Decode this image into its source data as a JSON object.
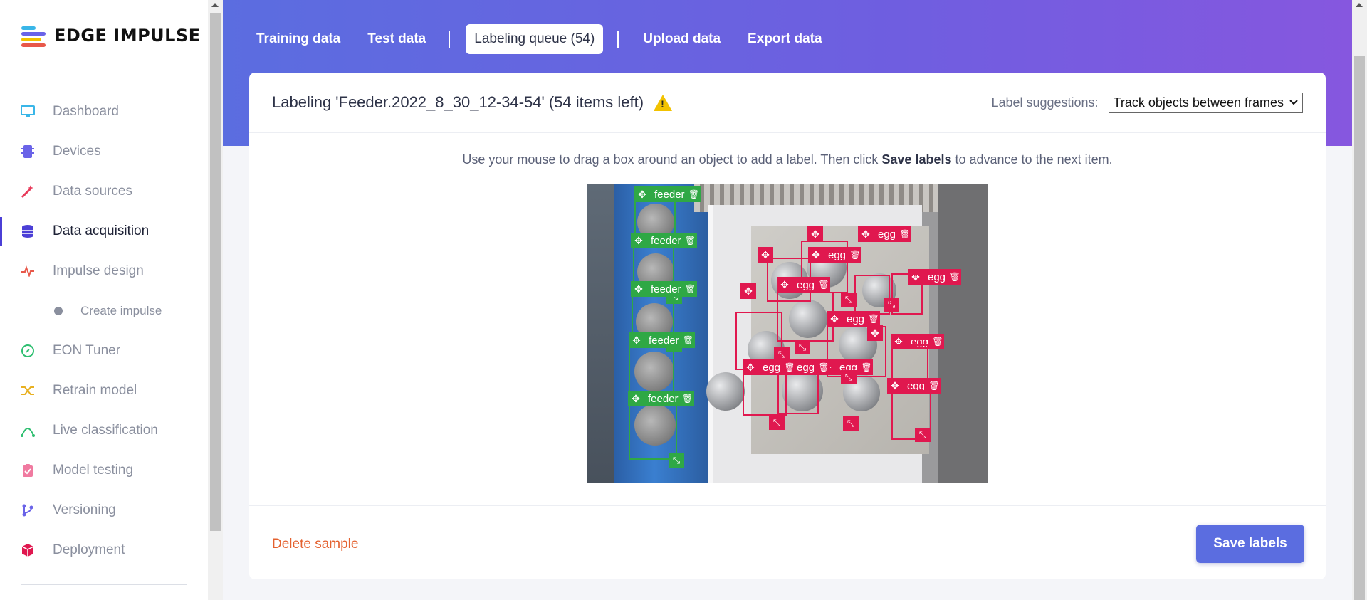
{
  "brand": {
    "name": "EDGE IMPULSE",
    "colors": [
      "#5b6de0",
      "#f2c200",
      "#e0184f",
      "#2fa845"
    ]
  },
  "sidebar": {
    "items": [
      {
        "label": "Dashboard",
        "icon": "monitor-icon",
        "color": "#39b6e8"
      },
      {
        "label": "Devices",
        "icon": "chip-icon",
        "color": "#6a63e8"
      },
      {
        "label": "Data sources",
        "icon": "wand-icon",
        "color": "#e83a5a"
      },
      {
        "label": "Data acquisition",
        "icon": "database-icon",
        "color": "#4b3fd6",
        "active": true
      },
      {
        "label": "Impulse design",
        "icon": "pulse-icon",
        "color": "#e8584a"
      },
      {
        "label": "Create impulse",
        "icon": "dot-icon",
        "sub": true
      },
      {
        "label": "EON Tuner",
        "icon": "compass-icon",
        "color": "#2fbf71"
      },
      {
        "label": "Retrain model",
        "icon": "shuffle-icon",
        "color": "#e8b020"
      },
      {
        "label": "Live classification",
        "icon": "signal-icon",
        "color": "#2fbf71"
      },
      {
        "label": "Model testing",
        "icon": "clipboard-icon",
        "color": "#f07aa0"
      },
      {
        "label": "Versioning",
        "icon": "branch-icon",
        "color": "#6a63e8"
      },
      {
        "label": "Deployment",
        "icon": "box-icon",
        "color": "#e0184f"
      }
    ]
  },
  "tabs": [
    {
      "label": "Training data"
    },
    {
      "label": "Test data"
    },
    {
      "label": "Labeling queue (54)",
      "active": true
    },
    {
      "label": "Upload data"
    },
    {
      "label": "Export data"
    }
  ],
  "card": {
    "title": "Labeling 'Feeder.2022_8_30_12-34-54' (54 items left)",
    "suggestions_label": "Label suggestions:",
    "suggestions_value": "Track objects between frames",
    "instruction_pre": "Use your mouse to drag a box around an object to add a label. Then click ",
    "instruction_bold": "Save labels",
    "instruction_post": " to advance to the next item.",
    "delete_label": "Delete sample",
    "save_label": "Save labels"
  },
  "boxes": [
    {
      "label": "feeder",
      "kind": "g"
    },
    {
      "label": "feeder",
      "kind": "g"
    },
    {
      "label": "feeder",
      "kind": "g"
    },
    {
      "label": "feeder",
      "kind": "g"
    },
    {
      "label": "feeder",
      "kind": "g"
    },
    {
      "label": "egg",
      "kind": "r"
    },
    {
      "label": "egg",
      "kind": "r"
    },
    {
      "label": "egg",
      "kind": "r"
    },
    {
      "label": "egg",
      "kind": "r"
    },
    {
      "label": "egg",
      "kind": "r"
    },
    {
      "label": "egg",
      "kind": "r"
    },
    {
      "label": "egg",
      "kind": "r"
    },
    {
      "label": "egg",
      "kind": "r"
    },
    {
      "label": "egg",
      "kind": "r"
    }
  ]
}
